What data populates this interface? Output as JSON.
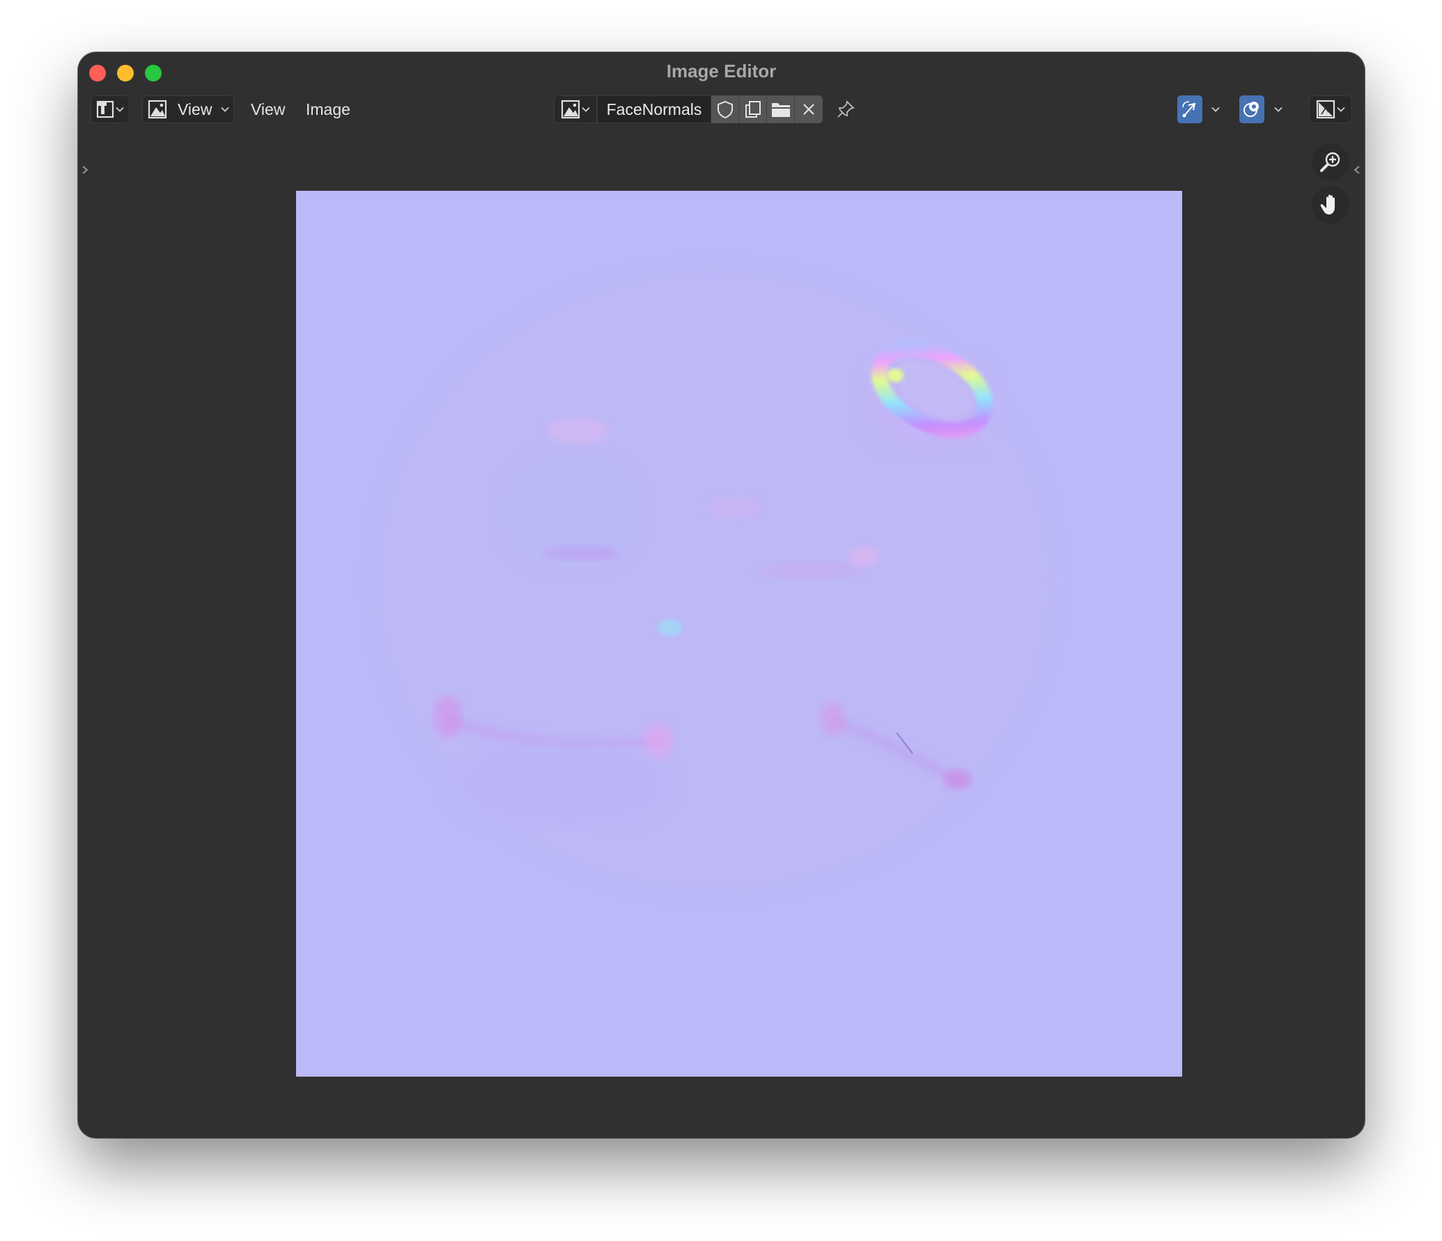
{
  "window": {
    "title": "Image Editor"
  },
  "header": {
    "view_mode_label": "View",
    "menus": [
      "View",
      "Image"
    ],
    "image_name": "FaceNormals"
  },
  "viewport": {
    "image": "normal-map-texture",
    "base_color": "#bcb9f8"
  },
  "icons": {
    "editor_type": "image-editor-icon",
    "mode": "image-icon",
    "browse_image": "image-browse-icon",
    "fake_user": "shield-icon",
    "new_image": "duplicate-icon",
    "open_image": "folder-icon",
    "unlink": "close-icon",
    "pin": "pin-icon",
    "gizmo": "gizmo-icon",
    "overlay": "overlay-icon",
    "display_channels": "channels-icon",
    "zoom": "zoom-in-icon",
    "pan": "hand-icon"
  },
  "colors": {
    "accent": "#4772b3",
    "window_bg": "#303030"
  }
}
